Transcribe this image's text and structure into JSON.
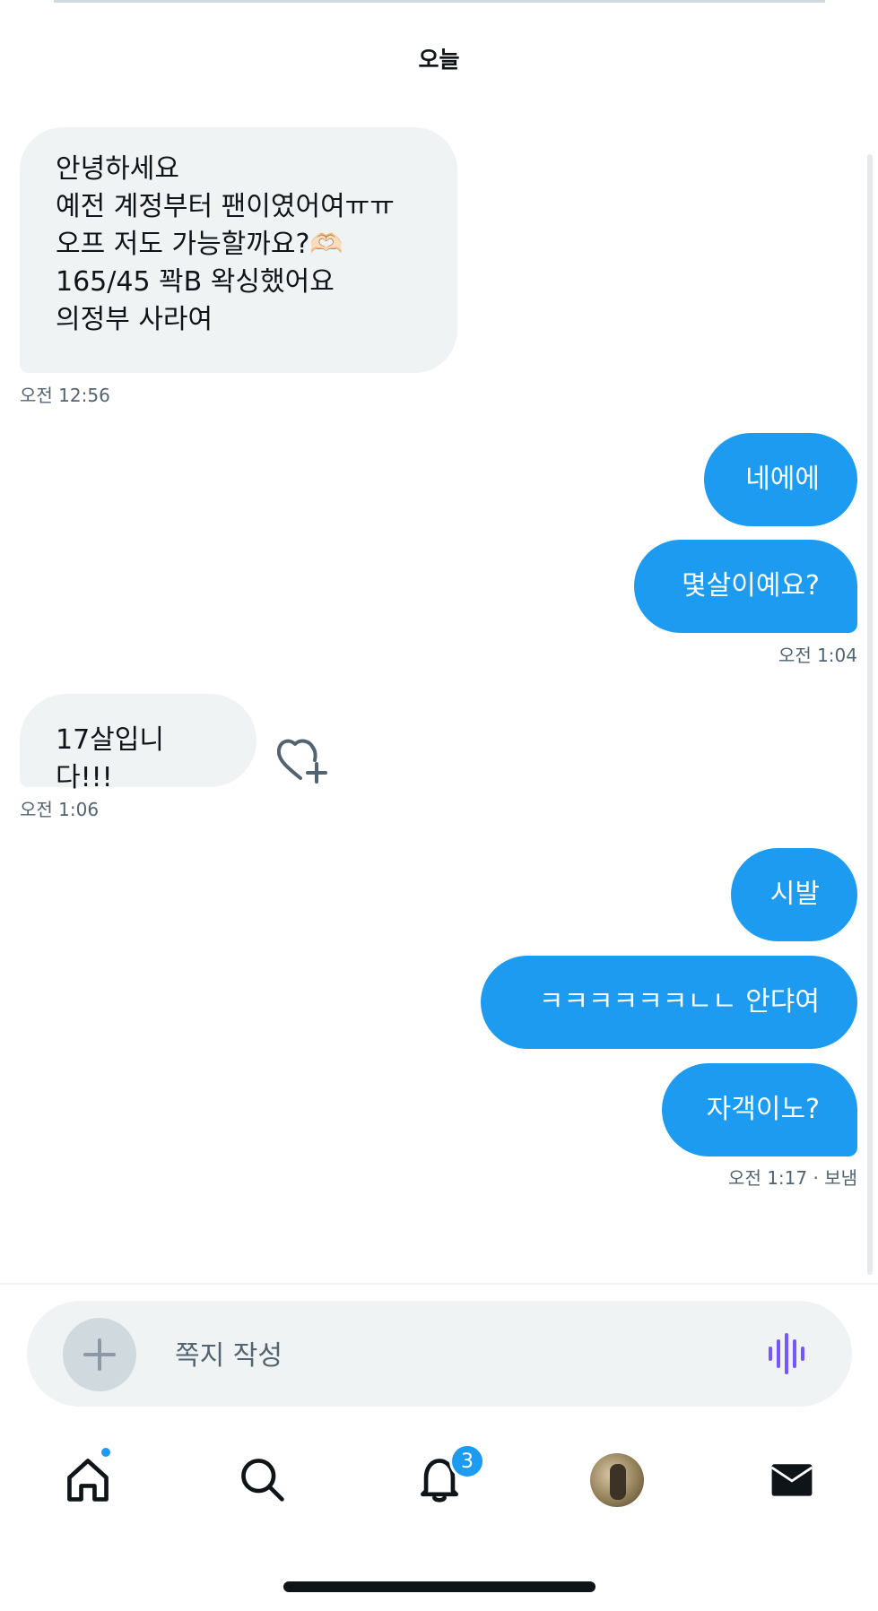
{
  "thread": {
    "date_divider": "오늘"
  },
  "messages": [
    {
      "direction": "in",
      "text": "안녕하세요\n예전 계정부터 팬이였어여ㅠㅠ\n오프 저도 가능할까요?🫶🏻\n165/45 꽉B 왁싱했어요\n의정부 사라여"
    },
    {
      "direction": "in",
      "time": "오전 12:56"
    },
    {
      "direction": "out",
      "text": "네에에"
    },
    {
      "direction": "out",
      "text": "몇살이예요?"
    },
    {
      "direction": "out",
      "time": "오전 1:04"
    },
    {
      "direction": "in",
      "text": "17살입니다!!!"
    },
    {
      "direction": "in",
      "time": "오전 1:06"
    },
    {
      "direction": "out",
      "text": "시발"
    },
    {
      "direction": "out",
      "text": "ㅋㅋㅋㅋㅋㅋㄴㄴ 안댜여"
    },
    {
      "direction": "out",
      "text": "자객이노?"
    },
    {
      "direction": "out",
      "time": "오전 1:17 · 보냄"
    }
  ],
  "composer": {
    "placeholder": "쪽지 작성",
    "add_icon": "plus-icon",
    "voice_icon": "voice-waveform-icon"
  },
  "tabbar": {
    "items": [
      {
        "icon": "home-icon",
        "has_dot": true
      },
      {
        "icon": "search-icon"
      },
      {
        "icon": "bell-icon",
        "badge": "3"
      },
      {
        "icon": "profile-avatar"
      },
      {
        "icon": "mail-icon"
      }
    ]
  },
  "colors": {
    "accent": "#1d9bf0",
    "incoming_bubble": "#eff3f4",
    "secondary_text": "#536471",
    "voice_icon": "#7856ff"
  }
}
